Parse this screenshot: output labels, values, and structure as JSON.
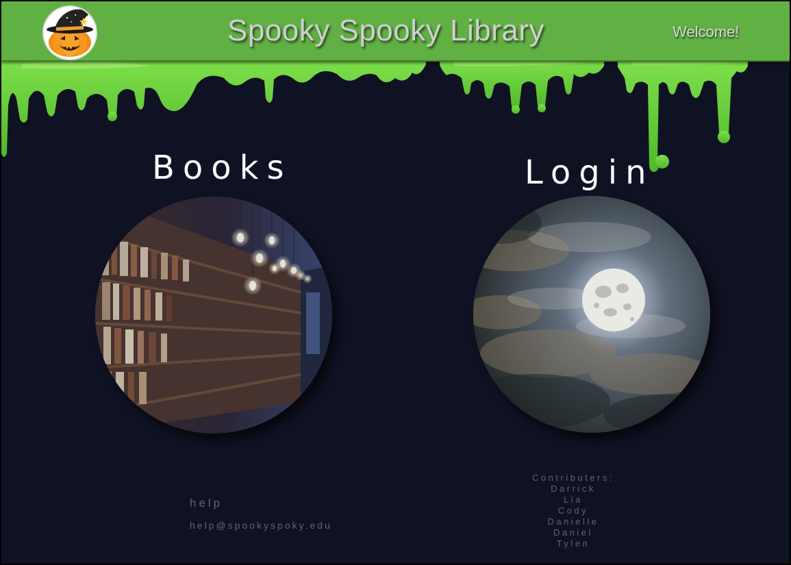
{
  "header": {
    "title": "Spooky Spooky Library",
    "welcome": "Welcome!",
    "logo_icon": "pumpkin-witch-hat-icon"
  },
  "books": {
    "title": "Books",
    "image": "library-bookshelves-image"
  },
  "login": {
    "title": "Login",
    "image": "full-moon-clouds-image"
  },
  "help": {
    "label": "help",
    "email": "help@spookyspoky.edu"
  },
  "contributors": {
    "label": "Contributers:",
    "names": [
      "Darrick",
      "Lia",
      "Cody",
      "Danielle",
      "Daniel",
      "Tylen"
    ]
  },
  "colors": {
    "header_bg": "#61b043",
    "page_bg": "#0f1223",
    "slime": "#6fd43a",
    "footer_text": "#5d6475"
  }
}
